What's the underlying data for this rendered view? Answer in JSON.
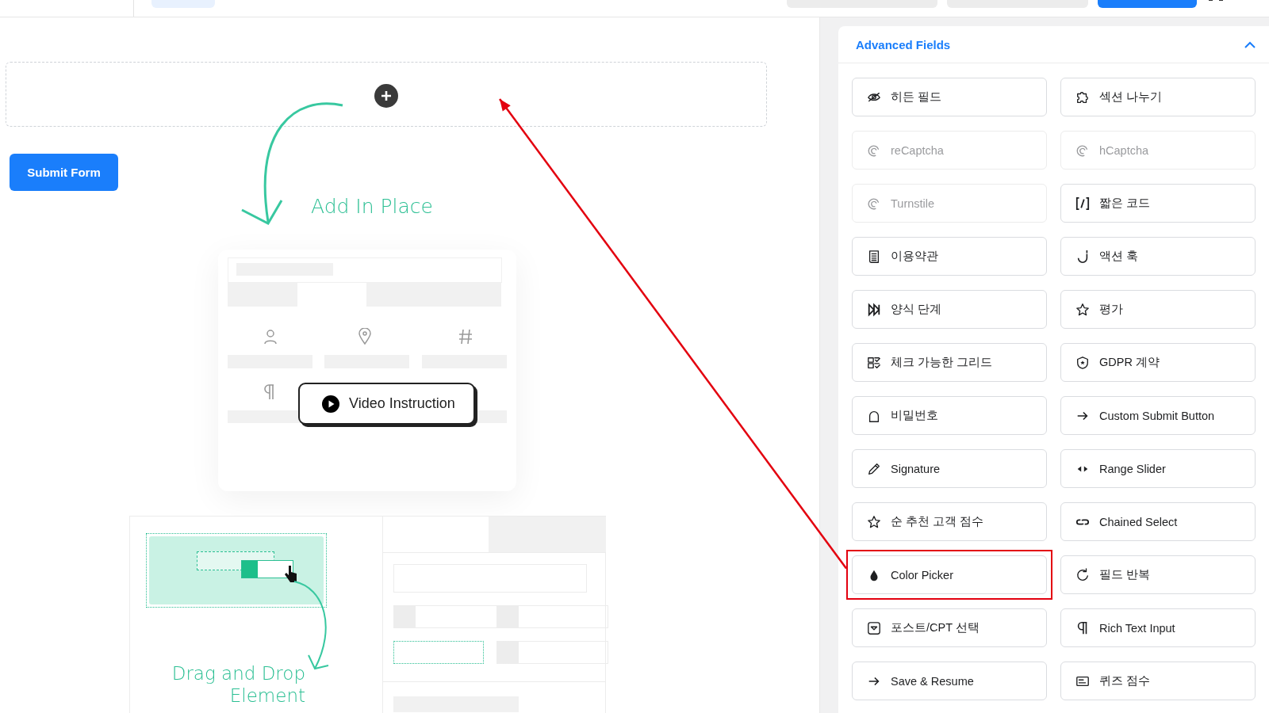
{
  "canvas": {
    "submit_button": "Submit Form",
    "illustration": {
      "add_label": "Add In Place",
      "video_button": "Video Instruction",
      "drag_label": [
        "Drag and Drop",
        "Element"
      ]
    }
  },
  "panel": {
    "title": "Advanced Fields",
    "expanded": true,
    "fields": [
      {
        "label": "히든 필드",
        "disabled": false,
        "highlighted": false
      },
      {
        "label": "섹션 나누기",
        "disabled": false,
        "highlighted": false
      },
      {
        "label": "reCaptcha",
        "disabled": true,
        "highlighted": false
      },
      {
        "label": "hCaptcha",
        "disabled": true,
        "highlighted": false
      },
      {
        "label": "Turnstile",
        "disabled": true,
        "highlighted": false
      },
      {
        "label": "짧은 코드",
        "disabled": false,
        "highlighted": false
      },
      {
        "label": "이용약관",
        "disabled": false,
        "highlighted": false
      },
      {
        "label": "액션 훅",
        "disabled": false,
        "highlighted": false
      },
      {
        "label": "양식 단계",
        "disabled": false,
        "highlighted": false
      },
      {
        "label": "평가",
        "disabled": false,
        "highlighted": false
      },
      {
        "label": "체크 가능한 그리드",
        "disabled": false,
        "highlighted": false
      },
      {
        "label": "GDPR 계약",
        "disabled": false,
        "highlighted": false
      },
      {
        "label": "비밀번호",
        "disabled": false,
        "highlighted": false
      },
      {
        "label": "Custom Submit Button",
        "disabled": false,
        "highlighted": false
      },
      {
        "label": "Signature",
        "disabled": false,
        "highlighted": false
      },
      {
        "label": "Range Slider",
        "disabled": false,
        "highlighted": false
      },
      {
        "label": "순 추천 고객 점수",
        "disabled": false,
        "highlighted": false
      },
      {
        "label": "Chained Select",
        "disabled": false,
        "highlighted": false
      },
      {
        "label": "Color Picker",
        "disabled": false,
        "highlighted": true
      },
      {
        "label": "필드 반복",
        "disabled": false,
        "highlighted": false
      },
      {
        "label": "포스트/CPT 선택",
        "disabled": false,
        "highlighted": false
      },
      {
        "label": "Rich Text Input",
        "disabled": false,
        "highlighted": false
      },
      {
        "label": "Save & Resume",
        "disabled": false,
        "highlighted": false
      },
      {
        "label": "퀴즈 점수",
        "disabled": false,
        "highlighted": false
      }
    ]
  }
}
